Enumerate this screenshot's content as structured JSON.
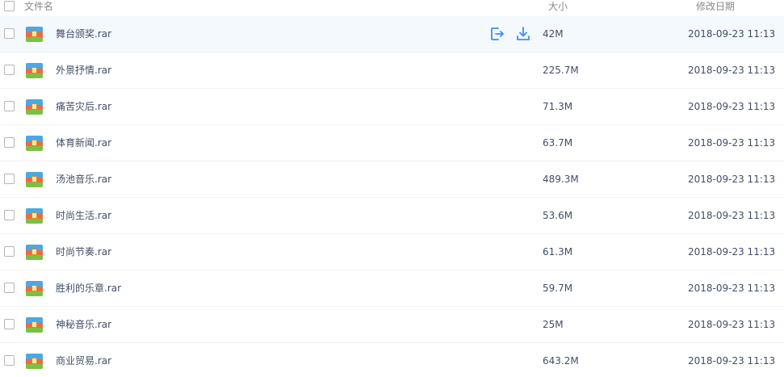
{
  "header": {
    "name_label": "文件名",
    "size_label": "大小",
    "date_label": "修改日期"
  },
  "colors": {
    "accent": "#3b8cff",
    "hover_row": "#f4f9fe",
    "text": "#424e67"
  },
  "files": [
    {
      "name": "舞台颁奖.rar",
      "size": "42M",
      "date": "2018-09-23 11:13"
    },
    {
      "name": "外景抒情.rar",
      "size": "225.7M",
      "date": "2018-09-23 11:13"
    },
    {
      "name": "痛苦灾后.rar",
      "size": "71.3M",
      "date": "2018-09-23 11:13"
    },
    {
      "name": "体育新闻.rar",
      "size": "63.7M",
      "date": "2018-09-23 11:13"
    },
    {
      "name": "汤池音乐.rar",
      "size": "489.3M",
      "date": "2018-09-23 11:13"
    },
    {
      "name": "时尚生活.rar",
      "size": "53.6M",
      "date": "2018-09-23 11:13"
    },
    {
      "name": "时尚节奏.rar",
      "size": "61.3M",
      "date": "2018-09-23 11:13"
    },
    {
      "name": "胜利的乐章.rar",
      "size": "59.7M",
      "date": "2018-09-23 11:13"
    },
    {
      "name": "神秘音乐.rar",
      "size": "25M",
      "date": "2018-09-23 11:13"
    },
    {
      "name": "商业贸易.rar",
      "size": "643.2M",
      "date": "2018-09-23 11:13"
    }
  ],
  "row_actions": {
    "share_icon": "share-icon",
    "download_icon": "download-icon"
  }
}
